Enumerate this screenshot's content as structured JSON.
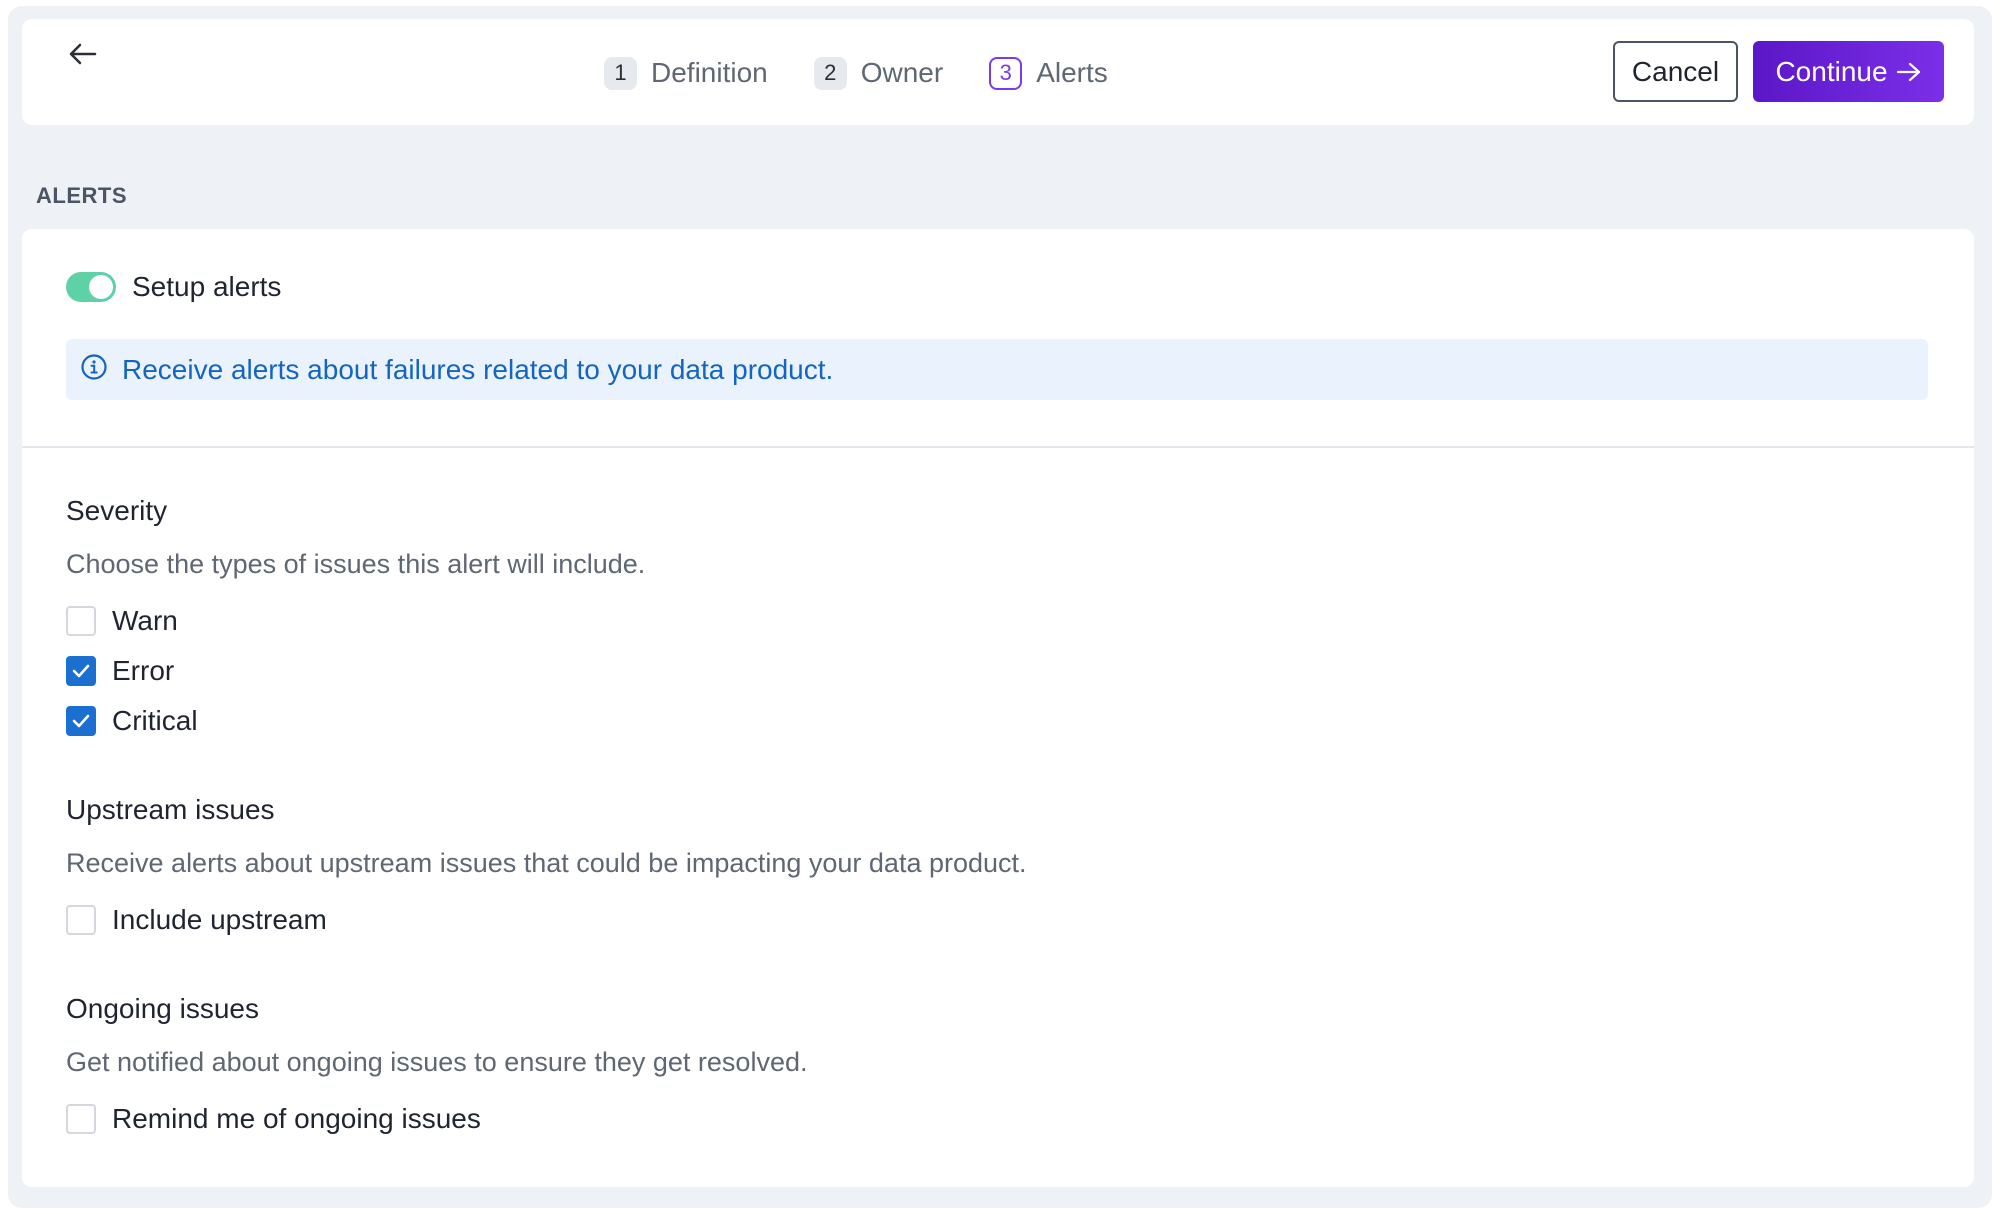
{
  "header": {
    "steps": [
      {
        "num": "1",
        "label": "Definition",
        "active": false
      },
      {
        "num": "2",
        "label": "Owner",
        "active": false
      },
      {
        "num": "3",
        "label": "Alerts",
        "active": true
      }
    ],
    "cancel_label": "Cancel",
    "continue_label": "Continue"
  },
  "section_label": "ALERTS",
  "setup": {
    "toggle_label": "Setup alerts",
    "toggle_on": true,
    "info_text": "Receive alerts about failures related to your data product."
  },
  "severity": {
    "title": "Severity",
    "description": "Choose the types of issues this alert will include.",
    "options": [
      {
        "label": "Warn",
        "checked": false
      },
      {
        "label": "Error",
        "checked": true
      },
      {
        "label": "Critical",
        "checked": true
      }
    ]
  },
  "upstream": {
    "title": "Upstream issues",
    "description": "Receive alerts about upstream issues that could be impacting your data product.",
    "option_label": "Include upstream",
    "checked": false
  },
  "ongoing": {
    "title": "Ongoing issues",
    "description": "Get notified about ongoing issues to ensure they get resolved.",
    "option_label": "Remind me of ongoing issues",
    "checked": false
  },
  "colors": {
    "primary": "#6b21d8",
    "toggle": "#5fd1a7",
    "checkbox": "#1a6fd1",
    "info": "#1565c0"
  }
}
